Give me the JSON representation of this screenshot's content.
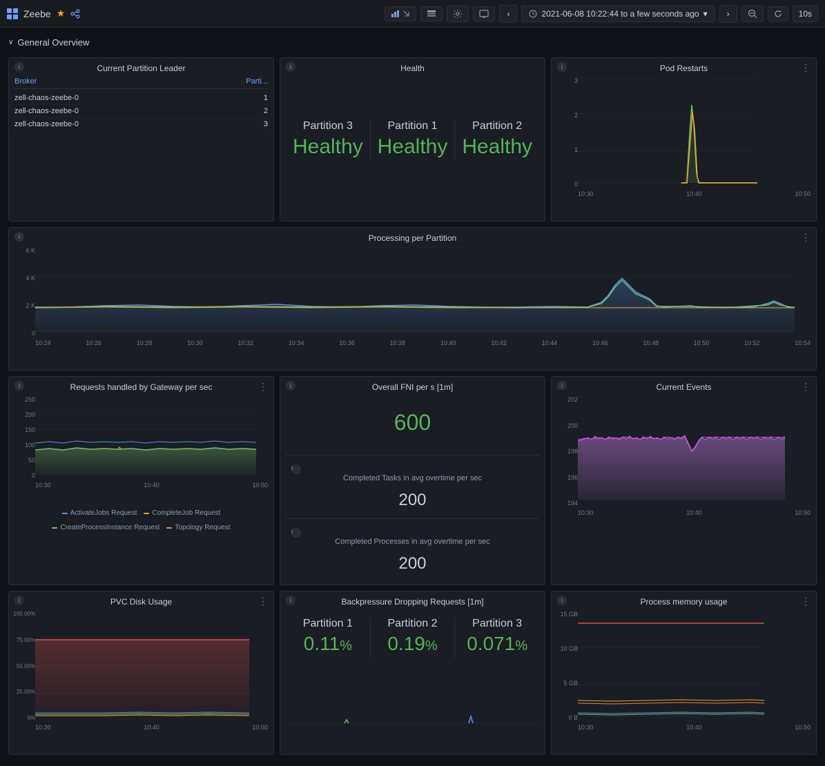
{
  "app": {
    "title": "Zeebe",
    "icon": "grid-icon",
    "star": "★",
    "share": "⇄"
  },
  "toolbar": {
    "time_range": "2021-06-08 10:22:44 to a few seconds ago",
    "refresh_interval": "10s",
    "nav_left": "‹",
    "nav_right": "›",
    "zoom_out": "⊖",
    "zoom_in": "↺"
  },
  "section": {
    "label": "General Overview",
    "chevron": "∨"
  },
  "partition_leader": {
    "title": "Current Partition Leader",
    "col_broker": "Broker",
    "col_partition": "Parti...",
    "rows": [
      {
        "broker": "zell-chaos-zeebe-0",
        "partition": "1"
      },
      {
        "broker": "zell-chaos-zeebe-0",
        "partition": "2"
      },
      {
        "broker": "zell-chaos-zeebe-0",
        "partition": "3"
      }
    ]
  },
  "health": {
    "title": "Health",
    "partitions": [
      {
        "label": "Partition 3",
        "status": "Healthy"
      },
      {
        "label": "Partition 1",
        "status": "Healthy"
      },
      {
        "label": "Partition 2",
        "status": "Healthy"
      }
    ]
  },
  "pod_restarts": {
    "title": "Pod Restarts",
    "y_labels": [
      "3",
      "2",
      "1",
      "0"
    ],
    "x_labels": [
      "10:30",
      "10:40",
      "10:50"
    ]
  },
  "processing": {
    "title": "Processing per Partition",
    "y_labels": [
      "6 K",
      "4 K",
      "2 K",
      "0"
    ],
    "x_labels": [
      "10:24",
      "10:26",
      "10:28",
      "10:30",
      "10:32",
      "10:34",
      "10:36",
      "10:38",
      "10:40",
      "10:42",
      "10:44",
      "10:46",
      "10:48",
      "10:50",
      "10:52",
      "10:54"
    ]
  },
  "gateway_requests": {
    "title": "Requests handled by Gateway per sec",
    "y_labels": [
      "250",
      "200",
      "150",
      "100",
      "50",
      "0"
    ],
    "x_labels": [
      "10:30",
      "10:40",
      "10:50"
    ],
    "legend": [
      {
        "color": "#5794f2",
        "label": "ActivateJobs Request"
      },
      {
        "color": "#f5a623",
        "label": "CompleteJob Request"
      },
      {
        "color": "#73bf69",
        "label": "CreateProcessInstance Request"
      },
      {
        "color": "#e88b3e",
        "label": "Topology Request"
      }
    ]
  },
  "fni": {
    "title": "Overall FNI per s [1m]",
    "value": "600",
    "completed_tasks_label": "Completed Tasks in avg overtime per sec",
    "completed_tasks_value": "200",
    "completed_processes_label": "Completed Processes in avg overtime per sec",
    "completed_processes_value": "200"
  },
  "current_events": {
    "title": "Current Events",
    "y_labels": [
      "202",
      "200",
      "198",
      "196",
      "194"
    ],
    "x_labels": [
      "10:30",
      "10:40",
      "10:50"
    ]
  },
  "pvc_disk": {
    "title": "PVC Disk Usage",
    "y_labels": [
      "100.00%",
      "75.00%",
      "50.00%",
      "25.00%",
      "0%"
    ],
    "x_labels": [
      "10:30",
      "10:40",
      "10:50"
    ]
  },
  "backpressure": {
    "title": "Backpressure Dropping Requests [1m]",
    "partitions": [
      {
        "label": "Partition 1",
        "value": "0.11",
        "unit": "%"
      },
      {
        "label": "Partition 2",
        "value": "0.19",
        "unit": "%"
      },
      {
        "label": "Partition 3",
        "value": "0.071",
        "unit": "%"
      }
    ]
  },
  "process_memory": {
    "title": "Process memory usage",
    "y_labels": [
      "15 GB",
      "10 GB",
      "5 GB",
      "0 B"
    ],
    "x_labels": [
      "10:30",
      "10:40",
      "10:50"
    ]
  }
}
